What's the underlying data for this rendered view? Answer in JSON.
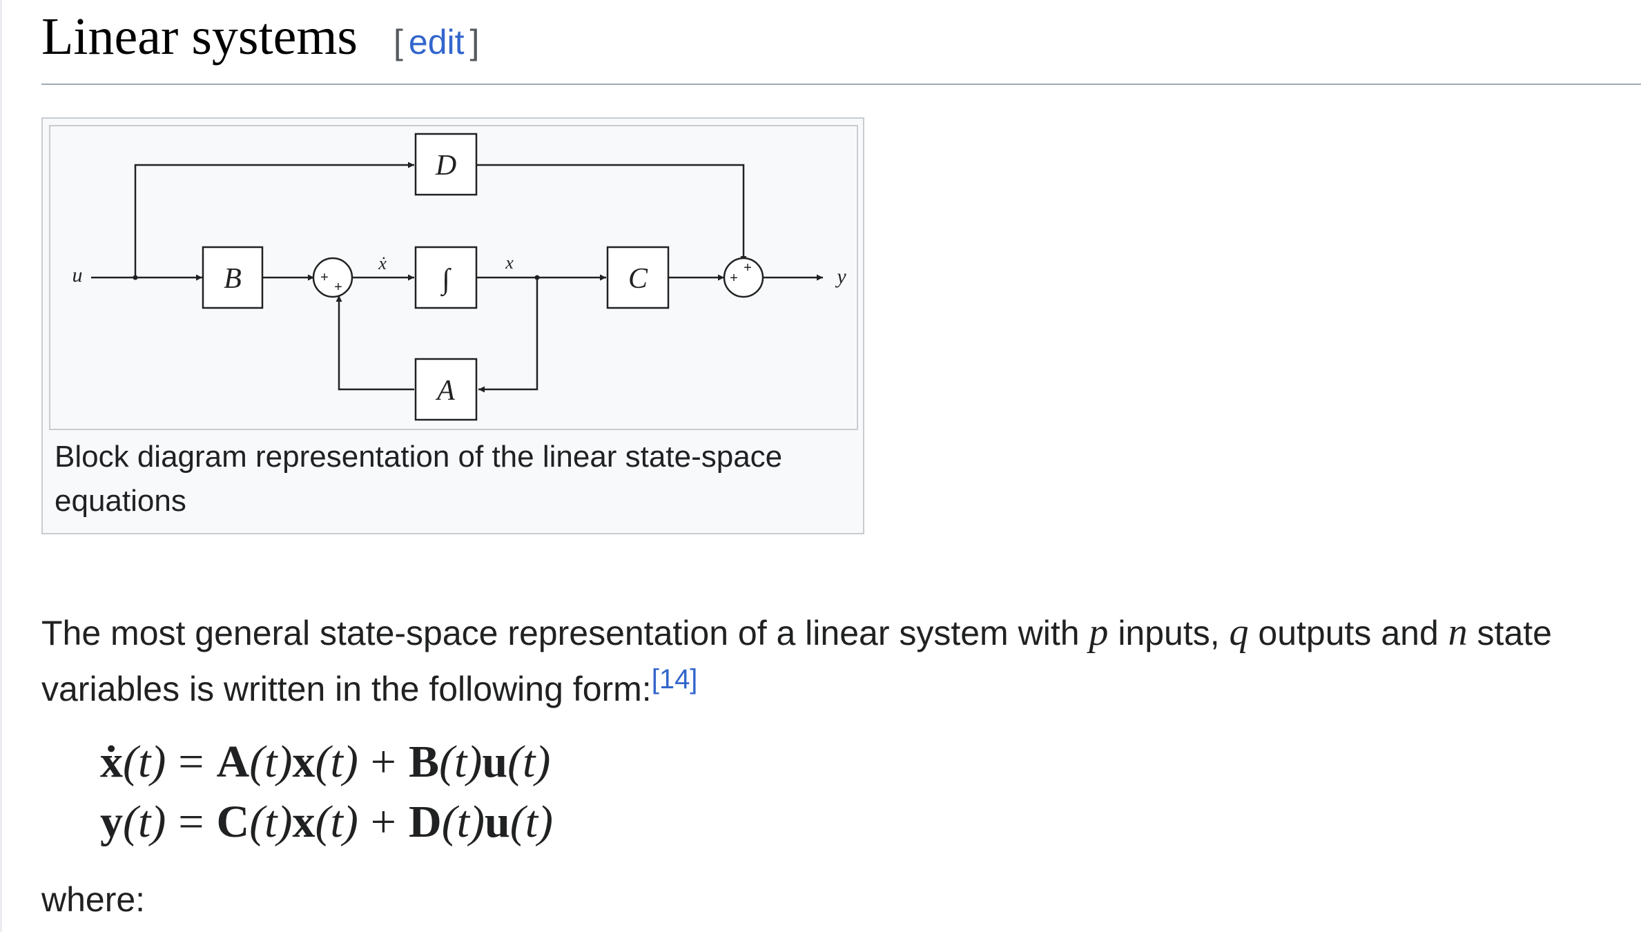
{
  "section": {
    "title": "Linear systems",
    "edit_bracket_open": "[",
    "edit_label": "edit",
    "edit_bracket_close": "]"
  },
  "figure": {
    "caption": "Block diagram representation of the linear state-space equations",
    "blocks": {
      "D": "D",
      "B": "B",
      "integrator": "∫",
      "C": "C",
      "A": "A"
    },
    "signals": {
      "input": "u",
      "state_derivative": "ẋ",
      "state": "x",
      "output": "y"
    },
    "summer_signs": {
      "sum1_left": "+",
      "sum1_bottom": "+",
      "sum2_left": "+",
      "sum2_top": "+"
    }
  },
  "paragraph": {
    "text1": "The most general state-space representation of a linear system with ",
    "var_p": "p",
    "text2": " inputs, ",
    "var_q": "q",
    "text3": " outputs and ",
    "var_n": "n",
    "text4": " state variables is written in the following form:",
    "ref": "[14]"
  },
  "equations": {
    "line1": {
      "lhs_vec": "ẋ",
      "lhs_arg": "(t)",
      "eq": "=",
      "m1": "A",
      "m1_arg": "(t)",
      "v1": "x",
      "v1_arg": "(t)",
      "plus": "+",
      "m2": "B",
      "m2_arg": "(t)",
      "v2": "u",
      "v2_arg": "(t)"
    },
    "line2": {
      "lhs_vec": "y",
      "lhs_arg": "(t)",
      "eq": "=",
      "m1": "C",
      "m1_arg": "(t)",
      "v1": "x",
      "v1_arg": "(t)",
      "plus": "+",
      "m2": "D",
      "m2_arg": "(t)",
      "v2": "u",
      "v2_arg": "(t)"
    }
  },
  "where_label": "where:"
}
